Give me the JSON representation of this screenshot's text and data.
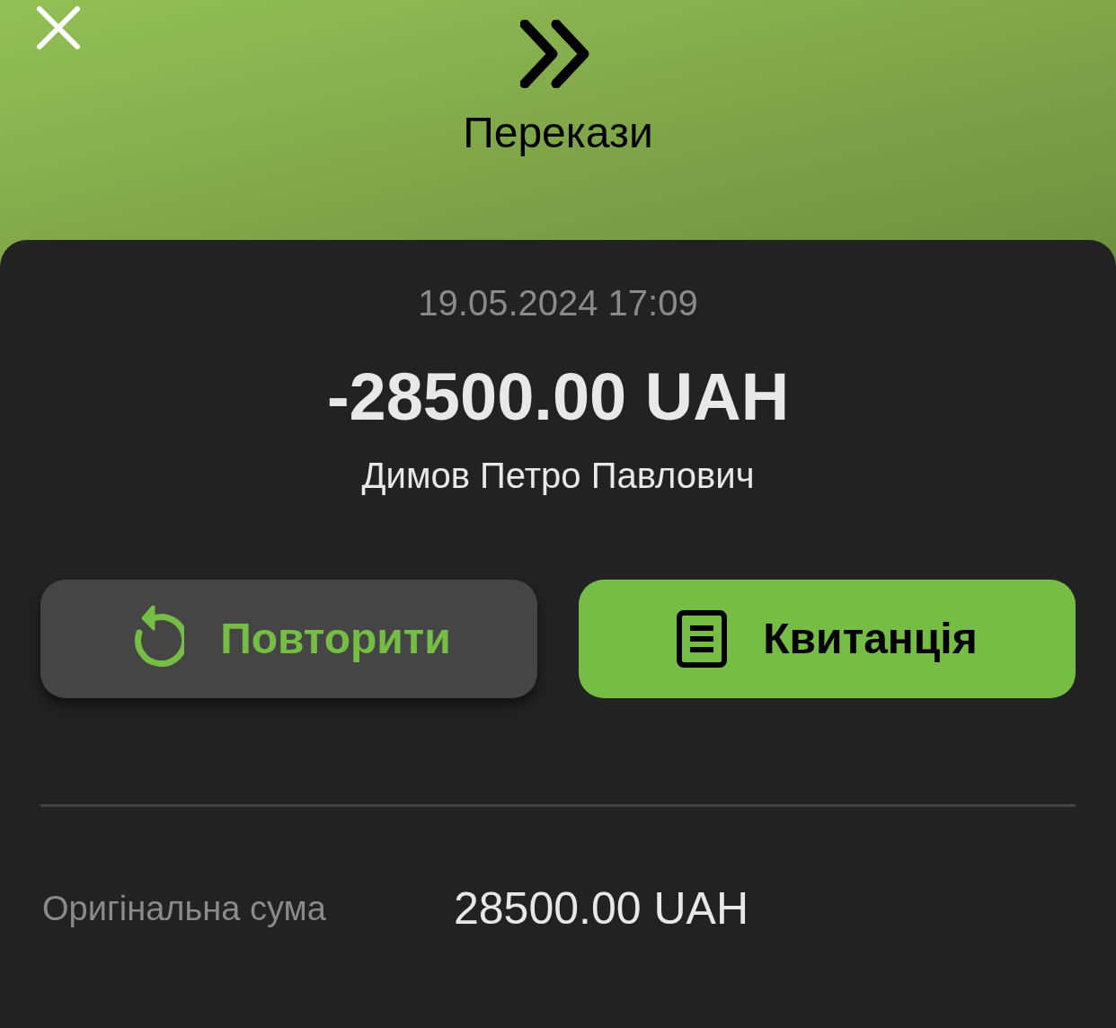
{
  "header": {
    "title": "Перекази"
  },
  "transaction": {
    "datetime": "19.05.2024 17:09",
    "amount": "-28500.00 UAH",
    "counterparty": "Димов Петро Павлович"
  },
  "actions": [
    {
      "kind": "repeat",
      "label": "Повторити"
    },
    {
      "kind": "receipt",
      "label": "Квитанція"
    }
  ],
  "details": [
    {
      "label": "Оригінальна сума",
      "value": "28500.00 UAH"
    }
  ]
}
